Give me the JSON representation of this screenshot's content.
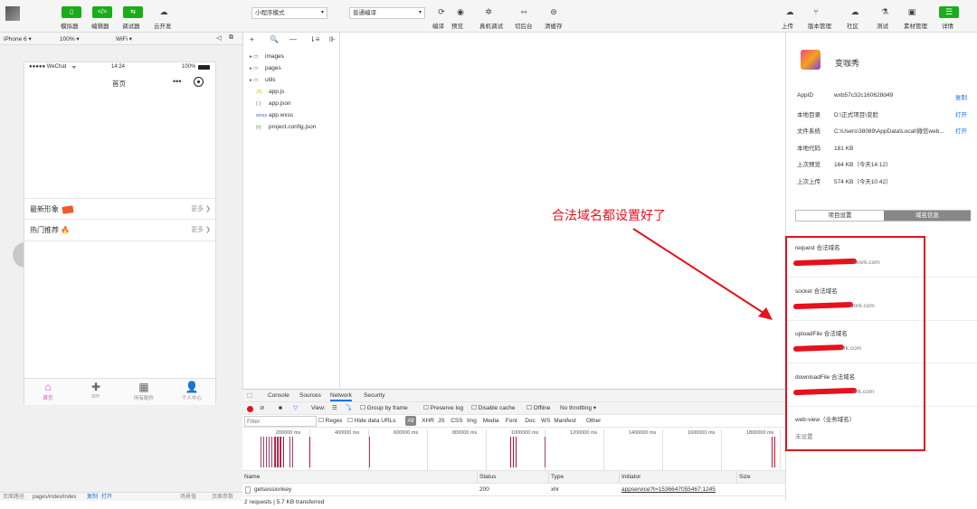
{
  "toolbar": {
    "left_buttons": [
      {
        "label": "模拟器",
        "icon": "phone-icon",
        "glyph": "▯"
      },
      {
        "label": "编辑器",
        "icon": "code-icon",
        "glyph": "</>"
      },
      {
        "label": "调试器",
        "icon": "debug-icon",
        "glyph": "⇆"
      }
    ],
    "cloud_label": "云开发",
    "mode_select": "小程序模式",
    "compile_select": "普通编译",
    "center_actions": [
      "编译",
      "预览",
      "真机调试",
      "切后台",
      "清缓存"
    ],
    "right_actions": [
      "上传",
      "版本管理",
      "社区",
      "测试",
      "素材管理",
      "详情"
    ]
  },
  "simulator_bar": {
    "device": "iPhone 6",
    "zoom": "100%",
    "network": "WiFi"
  },
  "phone": {
    "status_carrier": "●●●●● WeChat",
    "status_time": "14:24",
    "status_battery": "100%",
    "nav_title": "首页",
    "rows": [
      {
        "label": "最新形象",
        "more": "更多"
      },
      {
        "label": "热门推荐",
        "more": "更多"
      }
    ],
    "tabs": [
      "首页",
      "DIY",
      "所有配件",
      "个人中心"
    ]
  },
  "files": {
    "toolbar": [
      "+",
      "🔍",
      "—",
      "⇂≡",
      "⊪"
    ],
    "items": [
      {
        "name": "images",
        "type": "folder"
      },
      {
        "name": "pages",
        "type": "folder"
      },
      {
        "name": "utils",
        "type": "folder"
      },
      {
        "name": "app.js",
        "type": "js"
      },
      {
        "name": "app.json",
        "type": "json"
      },
      {
        "name": "app.wxss",
        "type": "wxss"
      },
      {
        "name": "project.config.json",
        "type": "config"
      }
    ]
  },
  "devtools": {
    "tabs": [
      "Console",
      "Sources",
      "Network",
      "Security"
    ],
    "active_tab": "Network",
    "filter_placeholder": "Filter",
    "toolbar_labels": [
      "View:",
      "Group by frame",
      "Preserve log",
      "Disable cache",
      "Offline",
      "No throttling"
    ],
    "filter_types": [
      "Regex",
      "Hide data URLs",
      "All",
      "XHR",
      "JS",
      "CSS",
      "Img",
      "Media",
      "Font",
      "Doc",
      "WS",
      "Manifest",
      "Other"
    ],
    "timeline_ticks": [
      "200000 ms",
      "400000 ms",
      "600000 ms",
      "800000 ms",
      "1000000 ms",
      "1200000 ms",
      "1400000 ms",
      "1600000 ms",
      "1800000 ms"
    ],
    "table_headers": [
      "Name",
      "Status",
      "Type",
      "Initiator",
      "Size"
    ],
    "rows": [
      {
        "name": "getsessionkey",
        "status": "200",
        "type": "xhr",
        "initiator": "appservice?t=1536647055467:1245",
        "size": ""
      }
    ],
    "summary": "2 requests | 5.7 KB transferred"
  },
  "details": {
    "app_name": "变咖秀",
    "fields": [
      {
        "key": "AppID",
        "value": "wxb57c32c160628d49",
        "action": "复制"
      },
      {
        "key": "本地目录",
        "value": "D:\\正式项目\\变脸",
        "action": "打开"
      },
      {
        "key": "文件系统",
        "value": "C:\\Users\\38089\\AppData\\Local\\微信web...",
        "action": "打开"
      },
      {
        "key": "本地代码",
        "value": "181 KB",
        "action": ""
      },
      {
        "key": "上次预览",
        "value": "164 KB（今天14:12）",
        "action": ""
      },
      {
        "key": "上次上传",
        "value": "574 KB（今天10:42）",
        "action": ""
      }
    ],
    "tabs": [
      "项目设置",
      "域名信息"
    ],
    "active_tab": "域名信息",
    "domains": [
      {
        "title": "request 合法域名",
        "value": "twork.com"
      },
      {
        "title": "socket 合法域名",
        "value": "work.com"
      },
      {
        "title": "uploadFile 合法域名",
        "value": "ork.com"
      },
      {
        "title": "downloadFile 合法域名",
        "value": "ork.com"
      },
      {
        "title": "web-view（业务域名）",
        "value": "未设置"
      }
    ]
  },
  "annotation": "合法域名都设置好了",
  "statusbar": {
    "path_label": "页面路径",
    "path": "pages/index/index",
    "copy": "复制",
    "open": "打开",
    "scene_label": "场景值",
    "params_label": "页面参数"
  },
  "colors": {
    "accent_green": "#1aad19",
    "annotation_red": "#e8101a",
    "link_blue": "#1a73e8"
  }
}
